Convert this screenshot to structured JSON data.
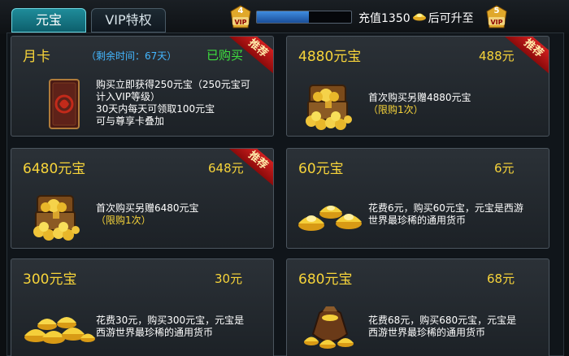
{
  "tabs": [
    {
      "label": "元宝"
    },
    {
      "label": "VIP特权"
    }
  ],
  "vip": {
    "current_level": "4",
    "next_level": "5",
    "badge_text": "VIP",
    "upgrade_prefix": "充值1350",
    "upgrade_suffix": "后可升至",
    "progress_fraction": 0.55
  },
  "colors": {
    "gold": "#f7d43a",
    "blue_text": "#44b7ff",
    "green_text": "#3fe03f",
    "ribbon_red": "#d11f1f"
  },
  "cards": [
    {
      "title": "月卡",
      "remaining": "（剩余时间：67天）",
      "status": "已购买",
      "ribbon": "推荐",
      "desc_lines": [
        "购买立即获得250元宝（250元宝可",
        "计入VIP等级）",
        "30天内每天可领取100元宝",
        "可与尊享卡叠加"
      ],
      "icon": "monthly-card-icon"
    },
    {
      "title": "4880元宝",
      "price": "488元",
      "ribbon": "推荐",
      "desc": "首次购买另赠4880元宝",
      "limit": "（限购1次）",
      "icon": "treasure-chest-icon"
    },
    {
      "title": "6480元宝",
      "price": "648元",
      "ribbon": "推荐",
      "desc": "首次购买另赠6480元宝",
      "limit": "（限购1次）",
      "icon": "treasure-chest-icon"
    },
    {
      "title": "60元宝",
      "price": "6元",
      "desc_lines": [
        "花费6元，购买60元宝，元宝是西游",
        "世界最珍稀的通用货币"
      ],
      "icon": "gold-ingots-icon"
    },
    {
      "title": "300元宝",
      "price": "30元",
      "desc_lines": [
        "花费30元，购买300元宝，元宝是",
        "西游世界最珍稀的通用货币"
      ],
      "icon": "gold-ingots-pile-icon"
    },
    {
      "title": "680元宝",
      "price": "68元",
      "desc_lines": [
        "花费68元，购买680元宝，元宝是",
        "西游世界最珍稀的通用货币"
      ],
      "icon": "gold-bag-icon"
    }
  ]
}
